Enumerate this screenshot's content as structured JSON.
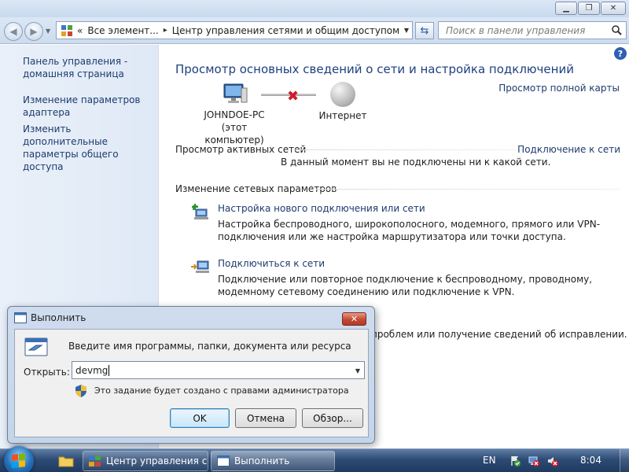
{
  "window": {
    "minimize_glyph": "▁",
    "maximize_glyph": "❐",
    "close_glyph": "✕"
  },
  "address_bar": {
    "overflow": "«",
    "crumbs": [
      "Все элемент...",
      "Центр управления сетями и общим доступом"
    ],
    "separator": "▸"
  },
  "search": {
    "placeholder": "Поиск в панели управления"
  },
  "sidebar": {
    "items": [
      {
        "label": "Панель управления - домашняя страница"
      },
      {
        "label": "Изменение параметров адаптера"
      },
      {
        "label": "Изменить дополнительные параметры общего доступа"
      }
    ]
  },
  "main": {
    "help": "?",
    "title": "Просмотр основных сведений о сети и настройка подключений",
    "full_map": "Просмотр полной карты",
    "computer_name": "JOHNDOE-PC",
    "computer_caption": "(этот компьютер)",
    "internet": "Интернет",
    "active_networks": {
      "title": "Просмотр активных сетей",
      "link": "Подключение к сети",
      "status": "В данный момент вы не подключены ни к какой сети."
    },
    "change_settings": {
      "title": "Изменение сетевых параметров",
      "tasks": [
        {
          "link": "Настройка нового подключения или сети",
          "desc": "Настройка беспроводного, широкополосного, модемного, прямого или VPN-подключения или же настройка маршрутизатора или точки доступа."
        },
        {
          "link": "Подключиться к сети",
          "desc": "Подключение или повторное подключение к беспроводному, проводному, модемному сетевому соединению или подключение к VPN."
        }
      ],
      "troubleshoot_tail": "проблем или получение сведений об исправлении."
    }
  },
  "run_dialog": {
    "title": "Выполнить",
    "description": "Введите имя программы, папки, документа или ресурса",
    "open_label": "Открыть:",
    "input_value": "devmg",
    "admin_note": "Это задание будет создано с правами администратора",
    "buttons": {
      "ok": "OK",
      "cancel": "Отмена",
      "browse": "Обзор..."
    }
  },
  "taskbar": {
    "buttons": [
      {
        "label": "Центр управления с..."
      },
      {
        "label": "Выполнить"
      }
    ],
    "language": "EN",
    "time": "8:04"
  },
  "colors": {
    "link": "#1e3b6e",
    "heading": "#1f3f7f",
    "error_x": "#d2192b",
    "sidebar_bg": "#e3ecf7"
  }
}
